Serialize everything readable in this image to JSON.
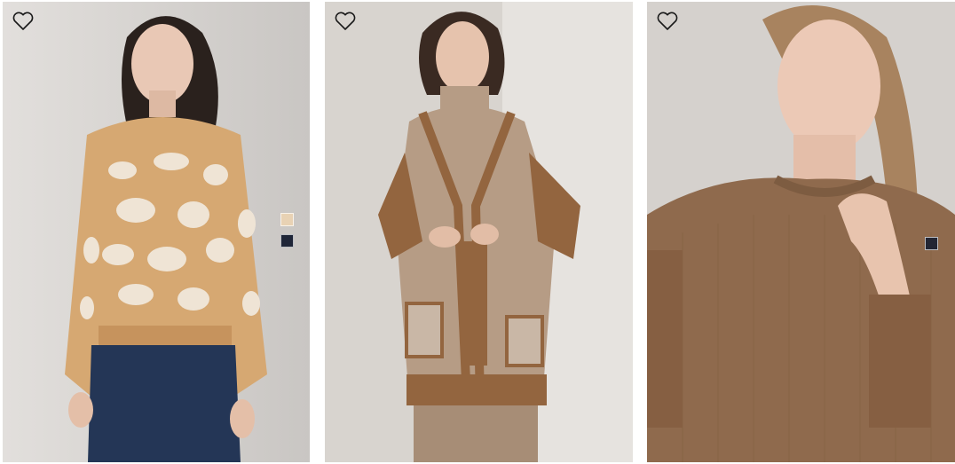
{
  "products": [
    {
      "wishlist_icon": "heart-outline-icon",
      "swatches": [
        {
          "color": "#e8d2b4"
        },
        {
          "color": "#1f2638"
        }
      ]
    },
    {
      "wishlist_icon": "heart-outline-icon",
      "swatches": []
    },
    {
      "wishlist_icon": "heart-outline-icon",
      "swatches": [
        {
          "color": "#232634"
        }
      ]
    }
  ],
  "colors": {
    "leopard_camel": "#d6a872",
    "leopard_cream": "#efe4d5",
    "denim": "#243656",
    "cardigan_oatmeal": "#b69c85",
    "cardigan_camel": "#93653f",
    "sweater_brown": "#8f6a4d"
  }
}
